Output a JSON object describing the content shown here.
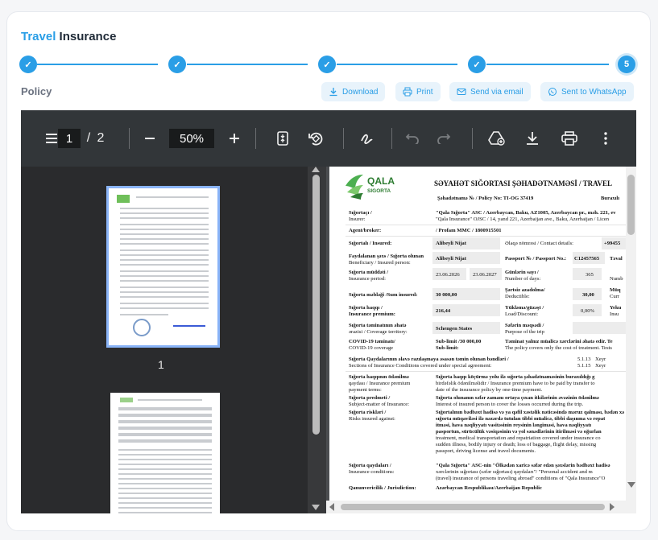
{
  "page": {
    "title_highlight": "Travel",
    "title_rest": "Insurance",
    "section": "Policy"
  },
  "steps": {
    "items": [
      "✓",
      "✓",
      "✓",
      "✓",
      "5"
    ],
    "current": 5,
    "accent": "#2a9ee6"
  },
  "actions": [
    {
      "label": "Download",
      "icon": "download-icon"
    },
    {
      "label": "Print",
      "icon": "print-icon"
    },
    {
      "label": "Send via email",
      "icon": "email-icon"
    },
    {
      "label": "Sent to WhatsApp",
      "icon": "whatsapp-icon"
    }
  ],
  "viewer": {
    "current_page": "1",
    "separator": "/",
    "total_pages": "2",
    "zoom": "50%",
    "thumb_label": "1",
    "toolbar_icons": [
      "menu-icon",
      "minus-icon",
      "plus-icon",
      "fit-page-icon",
      "rotate-icon",
      "draw-icon",
      "undo-icon",
      "redo-icon",
      "add-to-drive-icon",
      "download-icon",
      "print-icon",
      "more-icon"
    ]
  },
  "doc": {
    "logo_line1": "QALA",
    "logo_line2": "SIGORTA",
    "header": "SƏYAHƏT SIĞORTASI ŞƏHADƏTNAMƏSİ / TRAVEL",
    "cert_line": "Şəhadətnamə № / Policy No: TI-OG 37419",
    "issued": "Buraxılı",
    "insurer_label": "Sığortaçı /",
    "insurer_label_en": "Insurer:",
    "insurer_val1": "\"Qala Sığorta\" ASC / Azerbaycan, Baku, AZ1005, Azerbaycan pr., məh. 221, ev",
    "insurer_val2": "\"Qala Insurance\" OJSC / 14, yand 221, Azerbaijan ave., Baku, Azerbaijan / Licen",
    "agent_label": "Agent/broker:",
    "agent_val": "/ Profam MMC / 1800915501",
    "insured_label": "Sığortalı / Insured:",
    "insured_val": "Alibeyli Nijat",
    "contact_label": "Əlaqə nömrəsi / Contact details:",
    "contact_val": "+99455",
    "benef_label1": "Faydalanan şəxs / Sığorta olunan",
    "benef_label2": "Beneficiary / Insured person:",
    "benef_val": "Alibeyli Nijat",
    "passport_label": "Passport № / Passport No.:",
    "passport_val": "C12457565",
    "t_label": "Təval",
    "period_label1": "Sığorta müddəti /",
    "period_label2": "Insurance period:",
    "date_from": "23.06.2026",
    "date_to": "23.06.2027",
    "days_label1": "Günlərin sayı /",
    "days_label2": "Number of days:",
    "days_val": "365",
    "num_label": "Numb",
    "sum_label": "Sığorta məbləği /Sum insured:",
    "sum_val": "30 000,00",
    "ded_label1": "Şərtsiz azadolma/",
    "ded_label2": "Deductible:",
    "ded_val": "30,00",
    "mu_label": "Müq",
    "cur_label": "Curr",
    "prem_label1": "Sığorta haqqı /",
    "prem_label2": "Insurance premium:",
    "prem_val": "216,44",
    "load_label1": "Yükləmə/güzəşt /",
    "load_label2": "Load/Discount:",
    "load_val": "0,00%",
    "yek_label": "Yeku",
    "insu_label": "Insu",
    "terr_label1": "Sığorta təminatının əhatə",
    "terr_label2": "ərazisi / Coverage territory:",
    "terr_val": "Schengen States",
    "purp_label1": "Səfərin məqsədi /",
    "purp_label2": "Purpose of the trip",
    "covid_label1": "COVID-19 təminatı/",
    "covid_label2": "COVID-19 coverage",
    "covid_val1": "Sub-limit /30 000,00",
    "covid_val2": "Sub-limit:",
    "covid_note1": "Təminat yalnız müalicə xərclərini əhatə edir. Te",
    "covid_note2": "The policy covers only the cost of treatment. Tests",
    "sect_label1": "Sığorta Qaydalarının əlavə razılaşmaya əsasən təmin olunan bəndləri /",
    "sect_label2": "Sections of Insurance Conditions covered under special agreement:",
    "sect_a": "5.1.13",
    "sect_a2": "Xeyr",
    "sect_b": "5.1.15",
    "sect_b2": "Xeyr",
    "pay_label1": "Sığorta haqqının ödənilmə",
    "pay_label2": "qaydası / Insurance premium",
    "pay_label3": "payment terms:",
    "pay_val1": "Sığorta haqqı köçürmə yolu ilə sığorta şəhadətnaməsinin buraxıldığı g",
    "pay_val2": "birdəfəlik ödənilməlidir / Insurance premium have to be paid by transfer to",
    "pay_val3": "date of the insurance policy by one-time payment.",
    "subj_label1": "Sığorta predmeti /",
    "subj_label2": "Subject-matter of Insurance:",
    "subj_val1": "Sığorta olunanın səfər zamanı ortaya çıxan itkilərinin əvəzinin ödənilmə",
    "subj_val2": "Interest of insured person to cover the losses occurred during the trip.",
    "risk_label1": "Sığorta riskləri /",
    "risk_label2": "Risks insured against:",
    "risk_val1": "Sığortalının bədbəxt hadisə və ya qəfil xəstəlik nəticəsində məruz qalması, bədən xə",
    "risk_val2": "sığorta müqaviləsi ilə nəzərdə tutulan tibbi müalicə, tibbi daşınma və repat",
    "risk_val3": "itməsi, hava nəqliyyatı vasitəsinin reysinin ləngiməsi, hava nəqliyyatı",
    "risk_val4": "pasportun, sürücülük vəsiqəsinin və yol sənədlərinin itirilməsi və oğurlan",
    "risk_val5": "treatment, medical transportation and repatriation covered under insurance co",
    "risk_val6": "sudden illness, bodily injury or death; loss of baggage, flight delay, missing",
    "risk_val7": "passport, driving license and travel documents.",
    "rules_label1": "Sığorta qaydaları /",
    "rules_label2": "Insurance conditions:",
    "rules_val1": "\"Qala Sığorta\" ASC-nin \"Ölkədən xaricə səfər edən şəxslərin bədbəxt hadisə",
    "rules_val2": "xərclərinin sığortası (səfər sığortası) qaydaları\"/ \"Personal accident and m",
    "rules_val3": "(travel) insurance of persons traveling abroad\" conditions of \"Qala Insurance\"O",
    "jur_label": "Qanunverіcilik / Jurisdiction:",
    "jur_val1": "Azərbaycan Respublikası/Azerbaijan Republic"
  }
}
